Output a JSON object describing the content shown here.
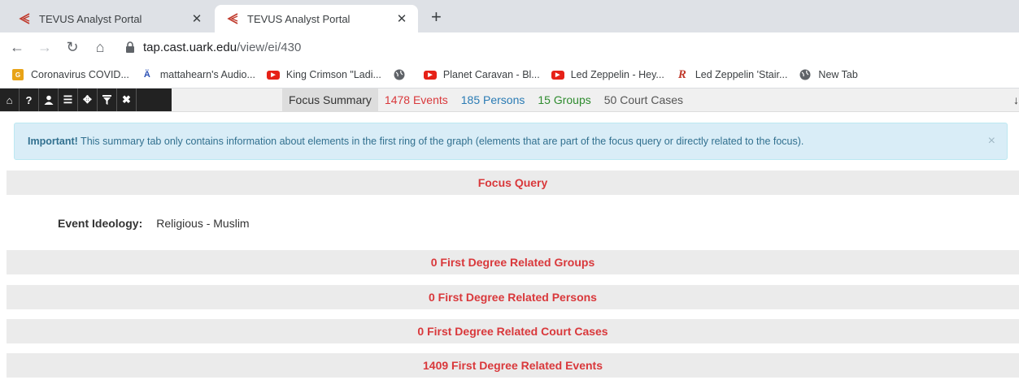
{
  "browser": {
    "tabs": [
      {
        "title": "TEVUS Analyst Portal",
        "active": false
      },
      {
        "title": "TEVUS Analyst Portal",
        "active": true
      }
    ],
    "new_tab_glyph": "+",
    "close_glyph": "✕",
    "url_domain": "tap.cast.uark.edu",
    "url_path": "/view/ei/430",
    "bookmarks": [
      {
        "label": "Coronavirus COVID...",
        "icon": "covid-icon"
      },
      {
        "label": "mattahearn's Audio...",
        "icon": "audio-icon"
      },
      {
        "label": "King Crimson \"Ladi...",
        "icon": "youtube-icon"
      },
      {
        "label": "",
        "icon": "globe-icon"
      },
      {
        "label": "Planet Caravan - Bl...",
        "icon": "youtube-icon"
      },
      {
        "label": "Led Zeppelin - Hey...",
        "icon": "youtube-icon"
      },
      {
        "label": "Led Zeppelin 'Stair...",
        "icon": "r-icon"
      },
      {
        "label": "New Tab",
        "icon": "globe-icon"
      }
    ]
  },
  "app": {
    "icons": [
      "home-icon",
      "help-icon",
      "user-icon",
      "list-icon",
      "move-icon",
      "filter-icon",
      "close-icon"
    ],
    "nav_tabs": [
      {
        "label": "Focus Summary",
        "style": "active"
      },
      {
        "label": "1478 Events",
        "style": "red"
      },
      {
        "label": "185 Persons",
        "style": "blue"
      },
      {
        "label": "15 Groups",
        "style": "green"
      },
      {
        "label": "50 Court Cases",
        "style": "gray"
      }
    ],
    "alert": {
      "strong": "Important!",
      "text": " This summary tab only contains information about elements in the first ring of the graph (elements that are part of the focus query or directly related to the focus).",
      "close": "×"
    },
    "sections": {
      "focus_query": "Focus Query",
      "groups": "0 First Degree Related Groups",
      "persons": "0 First Degree Related Persons",
      "court_cases": "0 First Degree Related Court Cases",
      "events": "1409 First Degree Related Events"
    },
    "focus_field": {
      "label": "Event Ideology:",
      "value": "Religious - Muslim"
    }
  },
  "colors": {
    "accent_red": "#d9383b",
    "alert_bg": "#d9edf7",
    "alert_text": "#31708f"
  }
}
